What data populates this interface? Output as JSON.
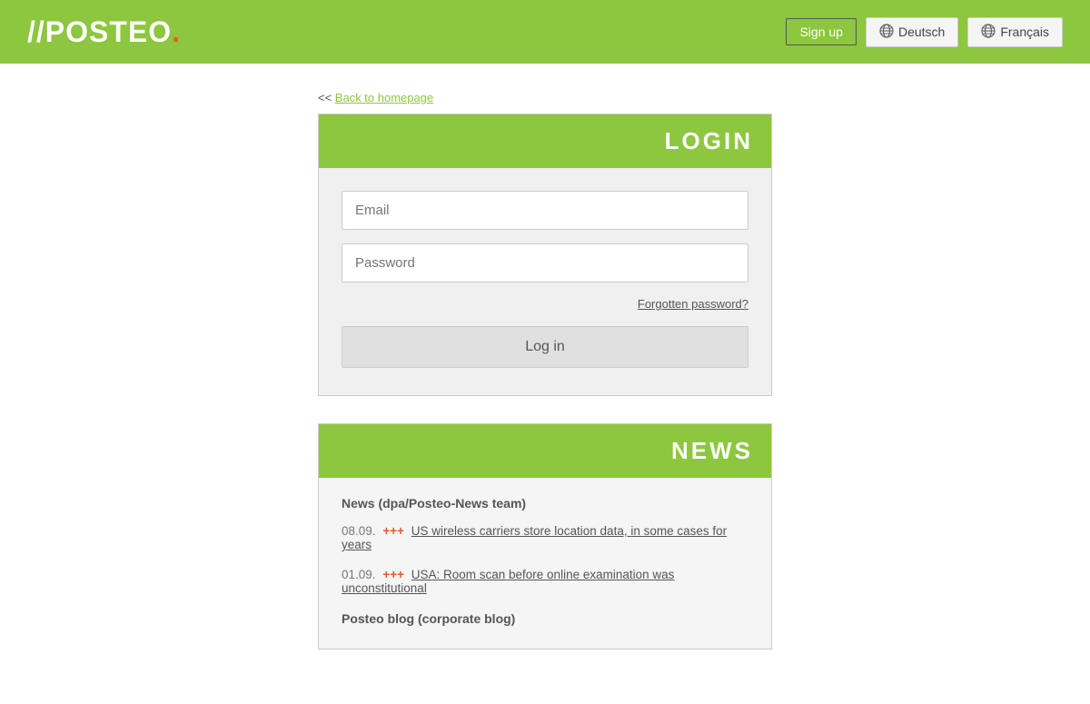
{
  "header": {
    "logo_prefix": "//POSTEO",
    "logo_dot": ".",
    "signup_label": "Sign up",
    "lang_de_label": "Deutsch",
    "lang_fr_label": "Français"
  },
  "back_link": {
    "prefix": "<< ",
    "label": "Back to homepage"
  },
  "login_section": {
    "title": "LOGIN",
    "email_placeholder": "Email",
    "password_placeholder": "Password",
    "forgot_label": "Forgotten password?",
    "login_btn_label": "Log in"
  },
  "news_section": {
    "title": "NEWS",
    "source_label": "News (dpa/Posteo-News team)",
    "items": [
      {
        "date": "08.09.",
        "plus": "+++",
        "link_text": "US wireless carriers store location data, in some cases for years"
      },
      {
        "date": "01.09.",
        "plus": "+++",
        "link_text": "USA: Room scan before online examination was unconstitutional"
      }
    ],
    "blog_label": "Posteo blog (corporate blog)"
  }
}
